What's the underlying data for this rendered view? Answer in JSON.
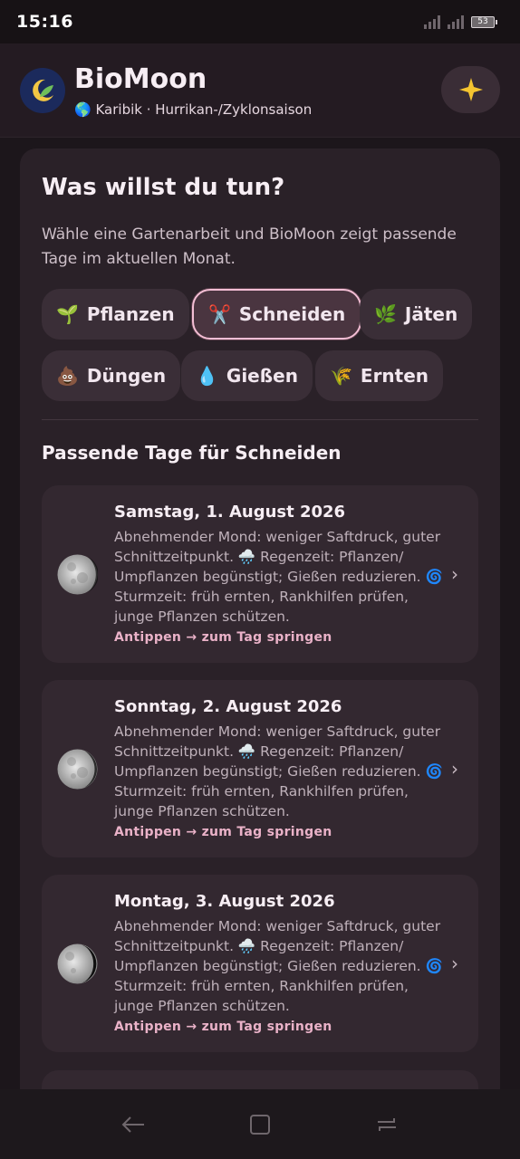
{
  "status": {
    "time": "15:16",
    "battery": "53"
  },
  "header": {
    "title": "BioMoon",
    "region_emoji": "🌎",
    "subtitle": "Karibik · Hurrikan-/Zyklonsaison",
    "sparkle_icon": "sparkle-icon"
  },
  "task_section": {
    "title": "Was willst du tun?",
    "intro": "Wähle eine Gartenarbeit und BioMoon zeigt passende Tage im aktuellen Monat.",
    "chips": [
      {
        "emoji": "🌱",
        "label": "Pflanzen",
        "selected": false
      },
      {
        "emoji": "✂️",
        "label": "Schneiden",
        "selected": true
      },
      {
        "emoji": "🌿",
        "label": "Jäten",
        "selected": false
      },
      {
        "emoji": "💩",
        "label": "Düngen",
        "selected": false
      },
      {
        "emoji": "💧",
        "label": "Gießen",
        "selected": false
      },
      {
        "emoji": "🌾",
        "label": "Ernten",
        "selected": false
      }
    ]
  },
  "results": {
    "title": "Passende Tage für Schneiden",
    "days": [
      {
        "date": "Samstag, 1. August 2026",
        "description": "Abnehmender Mond: weniger Saftdruck, guter Schnittzeitpunkt. 🌧️ Regenzeit: Pflanzen/ Umpflanzen begünstigt; Gießen reduzieren. 🌀 Sturmzeit: früh ernten, Rankhilfen prüfen, junge Pflanzen schützen.",
        "hint": "Antippen → zum Tag springen",
        "moon_illumination": 0.92
      },
      {
        "date": "Sonntag, 2. August 2026",
        "description": "Abnehmender Mond: weniger Saftdruck, guter Schnittzeitpunkt. 🌧️ Regenzeit: Pflanzen/ Umpflanzen begünstigt; Gießen reduzieren. 🌀 Sturmzeit: früh ernten, Rankhilfen prüfen, junge Pflanzen schützen.",
        "hint": "Antippen → zum Tag springen",
        "moon_illumination": 0.85
      },
      {
        "date": "Montag, 3. August 2026",
        "description": "Abnehmender Mond: weniger Saftdruck, guter Schnittzeitpunkt. 🌧️ Regenzeit: Pflanzen/ Umpflanzen begünstigt; Gießen reduzieren. 🌀 Sturmzeit: früh ernten, Rankhilfen prüfen, junge Pflanzen schützen.",
        "hint": "Antippen → zum Tag springen",
        "moon_illumination": 0.75
      }
    ]
  },
  "colors": {
    "accent": "#eab2c8",
    "background": "#1c161b",
    "card": "#2a2128"
  }
}
